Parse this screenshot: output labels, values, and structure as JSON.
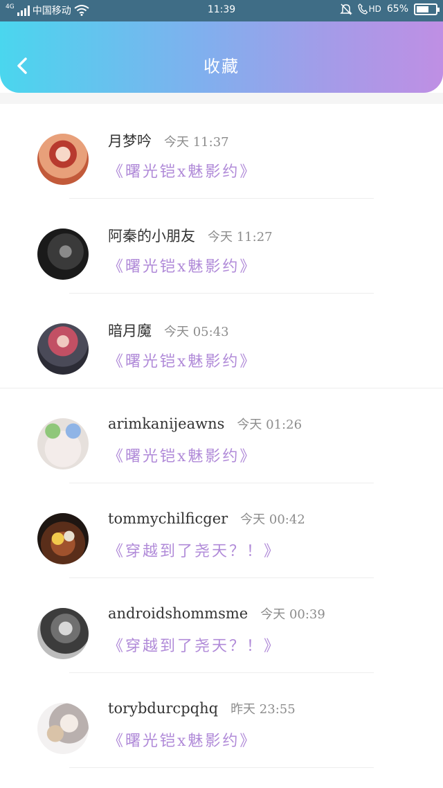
{
  "status_bar": {
    "network": "4G",
    "carrier": "中国移动",
    "time": "11:39",
    "hd": "HD",
    "battery": "65%",
    "battery_level": 0.65
  },
  "header": {
    "title": "收藏",
    "back_icon": "chevron-left-icon"
  },
  "colors": {
    "header_gradient": [
      "#4ad6ee",
      "#bf8fe4"
    ],
    "book_title": "#b08ad8",
    "name": "#333333",
    "time": "#8c8c8c"
  },
  "favorites": [
    {
      "name": "月梦吟",
      "time": "今天 11:37",
      "book": "《曙光铠x魅影约》"
    },
    {
      "name": "阿秦的小朋友",
      "time": "今天 11:27",
      "book": "《曙光铠x魅影约》"
    },
    {
      "name": "暗月魔",
      "time": "今天 05:43",
      "book": "《曙光铠x魅影约》"
    },
    {
      "name": "arimkanijeawns",
      "time": "今天 01:26",
      "book": "《曙光铠x魅影约》"
    },
    {
      "name": "tommychilficger",
      "time": "今天 00:42",
      "book": "《穿越到了尧天？！》"
    },
    {
      "name": "androidshommsme",
      "time": "今天 00:39",
      "book": "《穿越到了尧天？！》"
    },
    {
      "name": "torybdurcpqhq",
      "time": "昨天 23:55",
      "book": "《曙光铠x魅影约》"
    }
  ]
}
